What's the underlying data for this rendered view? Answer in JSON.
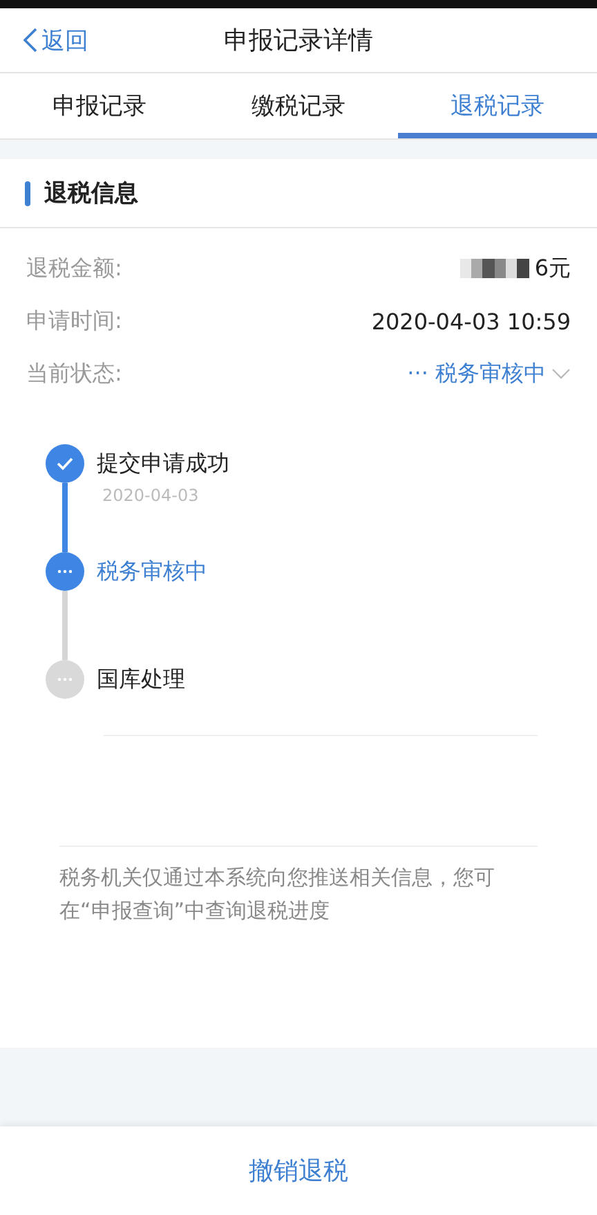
{
  "header": {
    "back": "返回",
    "title": "申报记录详情"
  },
  "tabs": [
    {
      "label": "申报记录",
      "selected": false
    },
    {
      "label": "缴税记录",
      "selected": false
    },
    {
      "label": "退税记录",
      "selected": true
    }
  ],
  "section": {
    "title": "退税信息"
  },
  "fields": [
    {
      "label": "退税金额:",
      "value": "6元",
      "redacted": true,
      "kind": "text"
    },
    {
      "label": "申请时间:",
      "value": "2020-04-03 10:59",
      "kind": "text"
    },
    {
      "label": "当前状态:",
      "value": "··· 税务审核中",
      "kind": "status"
    }
  ],
  "timeline": [
    {
      "label": "提交申请成功",
      "date": "2020-04-03",
      "kind": "done"
    },
    {
      "label": "税务审核中",
      "kind": "current"
    },
    {
      "label": "国库处理",
      "kind": "pending"
    }
  ],
  "note": "税务机关仅通过本系统向您推送相关信息，您可在“申报查询”中查询退税进度",
  "action": "撤销退税"
}
